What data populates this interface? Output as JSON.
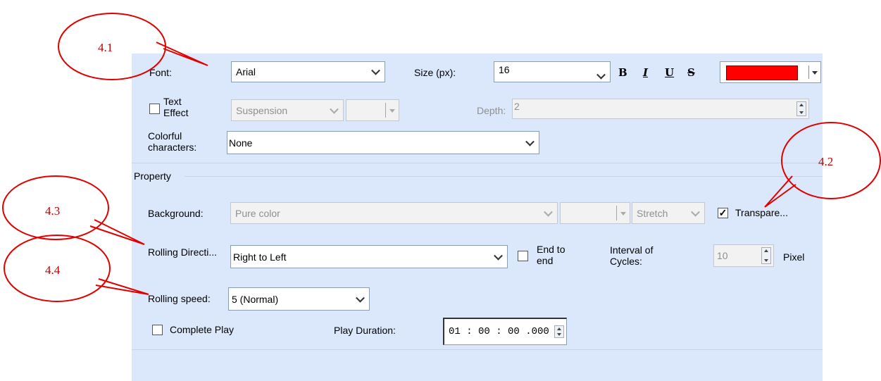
{
  "font": {
    "label": "Font:",
    "value": "Arial"
  },
  "size": {
    "label": "Size (px):",
    "value": "16"
  },
  "format": {
    "bold": "B",
    "italic": "I",
    "underline": "U",
    "strike": "S"
  },
  "font_color": "#ff0000",
  "text_effect": {
    "label": "Text Effect",
    "type": "Suspension",
    "depth_label": "Depth:",
    "depth_value": "2"
  },
  "colorful": {
    "label": "Colorful characters:",
    "value": "None"
  },
  "property": {
    "header": "Property"
  },
  "background": {
    "label": "Background:",
    "value": "Pure color",
    "mode": "Stretch",
    "transparent_label": "Transpare...",
    "transparent_checked": true
  },
  "rolling_direction": {
    "label": "Rolling Directi...",
    "value": "Right to Left",
    "end_to_end_label": "End to end"
  },
  "interval": {
    "label": "Interval of Cycles:",
    "value": "10",
    "unit": "Pixel"
  },
  "rolling_speed": {
    "label": "Rolling speed:",
    "value": "5 (Normal)"
  },
  "complete_play": {
    "label": "Complete Play"
  },
  "play_duration": {
    "label": "Play Duration:",
    "value": "01 : 00 : 00 .000"
  },
  "callouts": [
    "4.1",
    "4.2",
    "4.3",
    "4.4"
  ]
}
